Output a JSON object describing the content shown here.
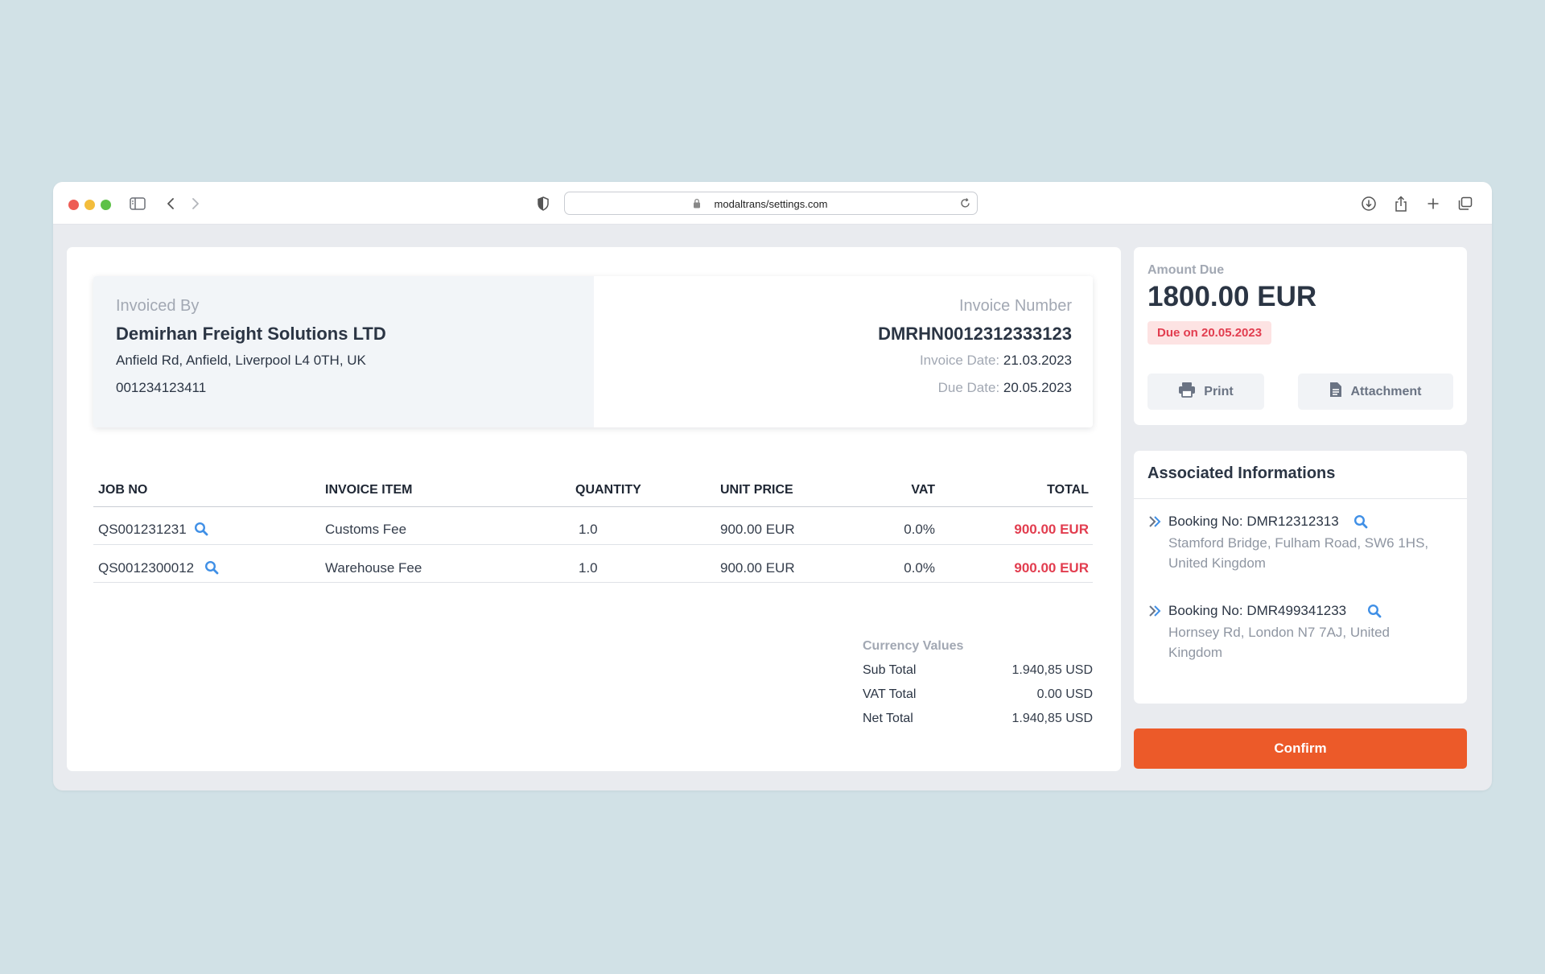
{
  "browser": {
    "url": "modaltrans/settings.com"
  },
  "invoice": {
    "invoiced_by_label": "Invoiced By",
    "company": "Demirhan Freight Solutions LTD",
    "address": "Anfield Rd, Anfield, Liverpool L4 0TH, UK",
    "phone": "001234123411",
    "number_label": "Invoice Number",
    "number": "DMRHN0012312333123",
    "invoice_date_label": "Invoice Date:",
    "invoice_date": "21.03.2023",
    "due_date_label": "Due Date:",
    "due_date": "20.05.2023"
  },
  "table": {
    "headers": [
      "JOB NO",
      "INVOICE ITEM",
      "QUANTITY",
      "UNIT PRICE",
      "VAT",
      "TOTAL"
    ],
    "rows": [
      {
        "job_no": "QS001231231",
        "item": "Customs Fee",
        "quantity": "1.0",
        "unit_price": "900.00 EUR",
        "vat": "0.0%",
        "total": "900.00 EUR"
      },
      {
        "job_no": "QS0012300012",
        "item": "Warehouse Fee",
        "quantity": "1.0",
        "unit_price": "900.00 EUR",
        "vat": "0.0%",
        "total": "900.00 EUR"
      }
    ]
  },
  "totals": {
    "heading": "Currency Values",
    "sub_total_label": "Sub Total",
    "sub_total": "1.940,85 USD",
    "vat_total_label": "VAT Total",
    "vat_total": "0.00 USD",
    "net_total_label": "Net Total",
    "net_total": "1.940,85 USD"
  },
  "amount": {
    "label": "Amount Due",
    "value": "1800.00 EUR",
    "due_badge": "Due on 20.05.2023",
    "print_label": "Print",
    "attachment_label": "Attachment"
  },
  "associated": {
    "title": "Associated Informations",
    "bookings": [
      {
        "title": "Booking No: DMR12312313",
        "address": "Stamford Bridge, Fulham Road, SW6 1HS, United Kingdom"
      },
      {
        "title": "Booking No: DMR499341233",
        "address": "Hornsey Rd, London N7 7AJ, United Kingdom"
      }
    ]
  },
  "confirm_label": "Confirm",
  "colors": {
    "accent": "#ec5a29",
    "danger": "#e23d4f",
    "link": "#3f8fe6",
    "background": "#d1e1e6"
  }
}
